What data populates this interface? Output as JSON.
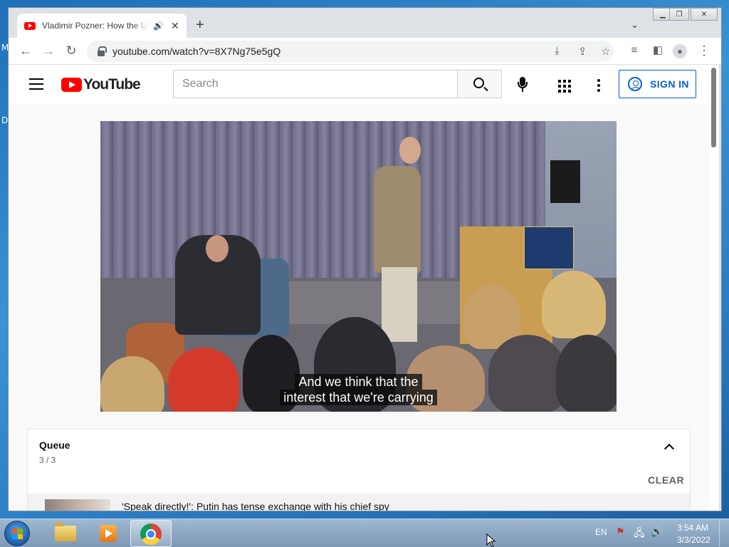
{
  "desktop": {
    "edge_letters": [
      "M",
      "D"
    ]
  },
  "browser": {
    "tab": {
      "title": "Vladimir Pozner: How the United States Created Vladimir Putin",
      "audio_icon": "speaker-icon"
    },
    "new_tab": "+",
    "url": "youtube.com/watch?v=8X7Ng75e5gQ",
    "window_controls": [
      "minimize",
      "restore",
      "close"
    ]
  },
  "youtube": {
    "logo_text": "YouTube",
    "search_placeholder": "Search",
    "sign_in": "SIGN IN",
    "video": {
      "caption_line1": "And we think that the",
      "caption_line2": "interest that we're carrying"
    },
    "queue": {
      "title": "Queue",
      "count": "3 / 3",
      "clear": "CLEAR",
      "items": [
        {
          "title": "'Speak directly!': Putin has tense exchange with his chief spy"
        }
      ]
    }
  },
  "taskbar": {
    "language": "EN",
    "time": "3:54 AM",
    "date": "3/3/2022"
  }
}
